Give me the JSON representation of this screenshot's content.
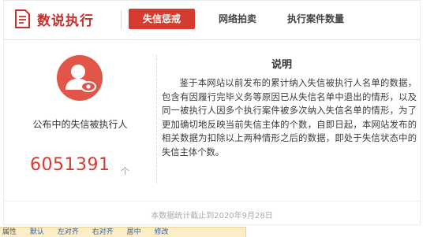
{
  "header": {
    "logo_text": "数说执行",
    "tabs": [
      {
        "label": "失信惩戒",
        "active": true
      },
      {
        "label": "网络拍卖",
        "active": false
      },
      {
        "label": "执行案件数量",
        "active": false
      }
    ]
  },
  "left_panel": {
    "label": "公布中的失信被执行人",
    "count": "6051391",
    "unit": "个"
  },
  "note": {
    "title": "说明",
    "body": "鉴于本网站以前发布的累计纳入失信被执行人名单的数据，包含有因履行完毕义务等原因已从失信名单中退出的情形，以及同一被执行人因多个执行案件被多次纳入失信名单的情形，为了更加确切地反映当前失信主体的个数，自即日起，本网站发布的相关数据为扣除以上两种情形之后的数据，即处于失信状态中的失信主体个数。"
  },
  "footer": {
    "text": "本数据统计截止到2020年9月28日"
  },
  "bottom_bar": {
    "items": [
      "属性",
      "默认",
      "左对齐",
      "右对齐",
      "居中",
      "修改"
    ]
  },
  "colors": {
    "brand_red": "#d63b2f",
    "avatar_red": "#e2564a"
  }
}
